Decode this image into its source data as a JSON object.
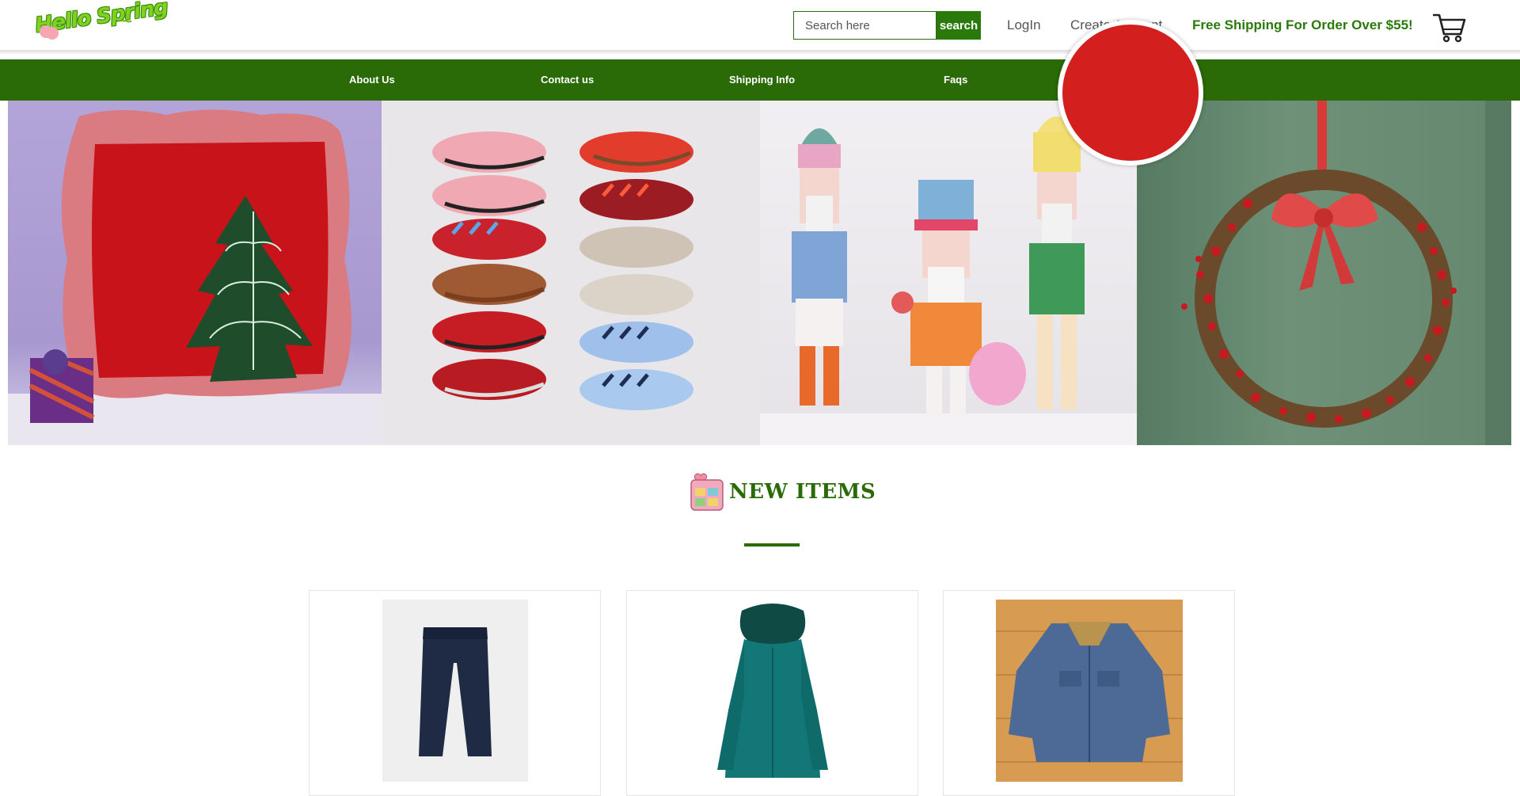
{
  "header": {
    "logo_text": "Hello Spring",
    "search_placeholder": "Search here",
    "search_button": "search",
    "login": "LogIn",
    "create_account": "Create Account",
    "shipping_note": "Free Shipping For Order Over $55!",
    "cart_icon": "cart-icon"
  },
  "nav": {
    "items": [
      "About Us",
      "Contact us",
      "Shipping Info",
      "Faqs"
    ]
  },
  "hero": {
    "panels": [
      "pillow-and-tree-cushion",
      "sneakers-grid",
      "nutcrackers",
      "berry-wreath"
    ],
    "badge_color": "#d41f1f"
  },
  "new_items": {
    "title": "NEW ITEMS",
    "products": [
      "dark-denim-jeans",
      "teal-puffer-coat",
      "denim-sherpa-jacket"
    ]
  },
  "colors": {
    "brand_green": "#2a6b08",
    "accent_green": "#2a7a0b",
    "logo_green": "#7ed321"
  }
}
